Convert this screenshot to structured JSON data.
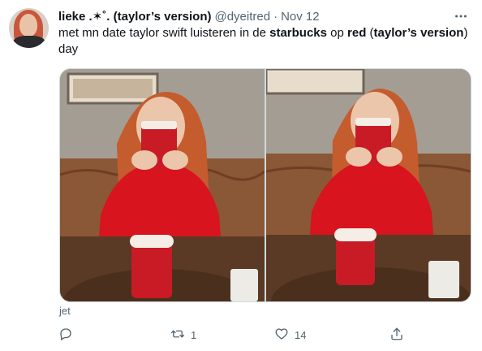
{
  "tweet": {
    "display_name": "lieke .✶˚.",
    "display_name_suffix": "(taylor’s version)",
    "handle": "@dyeitred",
    "separator": "·",
    "date": "Nov 12",
    "text_parts": [
      "met mn date taylor swift luisteren in de ",
      "starbucks",
      " op ",
      "red",
      " (",
      "taylor’s version",
      ") day"
    ],
    "media_caption": "jet",
    "replies_count": "",
    "retweets_count": "1",
    "likes_count": "14"
  },
  "icons": {
    "more": "more-horizontal-icon",
    "reply": "reply-icon",
    "retweet": "retweet-icon",
    "like": "heart-icon",
    "share": "share-icon"
  },
  "colors": {
    "text_primary": "#0f1419",
    "text_secondary": "#536471",
    "border": "#cfd9de",
    "sweater_red": "#d8141e"
  }
}
